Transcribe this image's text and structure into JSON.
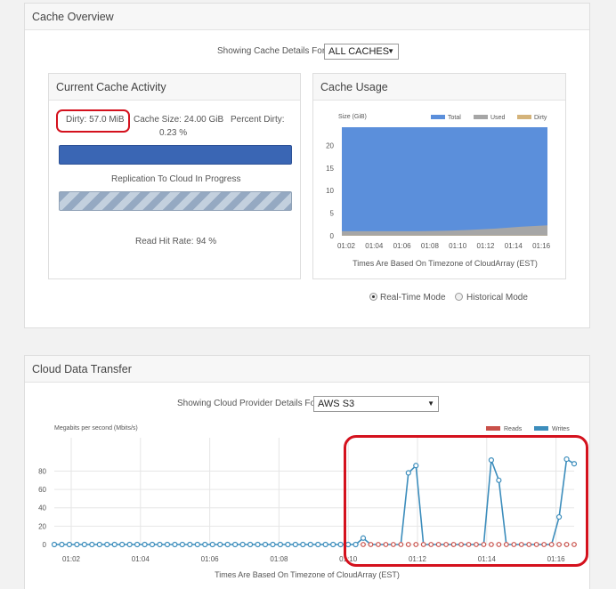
{
  "cache_overview": {
    "title": "Cache Overview",
    "showing_label": "Showing Cache Details For:",
    "cache_select": "ALL CACHES",
    "activity": {
      "title": "Current Cache Activity",
      "dirty": "Dirty: 57.0 MiB",
      "cache_size": "Cache Size: 24.00 GiB",
      "percent_dirty_label": "Percent Dirty:",
      "percent_dirty_value": "0.23 %",
      "replication_label": "Replication To Cloud In Progress",
      "read_hit_rate": "Read Hit Rate: 94 %"
    },
    "usage": {
      "title": "Cache Usage",
      "timezone_note": "Times Are Based On Timezone of CloudArray (EST)"
    },
    "modes": {
      "realtime": "Real-Time Mode",
      "historical": "Historical Mode",
      "selected": "realtime"
    }
  },
  "cloud_transfer": {
    "title": "Cloud Data Transfer",
    "showing_label": "Showing Cloud Provider Details For:",
    "provider_select": "AWS S3",
    "timezone_note": "Times Are Based On Timezone of CloudArray (EST)"
  },
  "colors": {
    "total": "#5b8fdb",
    "used": "#a6a6a6",
    "dirty": "#d4b37a",
    "reads": "#c9504a",
    "writes": "#3c8dbc",
    "highlight": "#d4111d"
  },
  "chart_data": [
    {
      "type": "area",
      "ylabel": "Size (GiB)",
      "x": [
        "01:02",
        "01:04",
        "01:06",
        "01:08",
        "01:10",
        "01:12",
        "01:14",
        "01:16"
      ],
      "yticks": [
        0,
        5,
        10,
        15,
        20
      ],
      "ylim": [
        0,
        24
      ],
      "legend": [
        "Total",
        "Used",
        "Dirty"
      ],
      "legend_position": "top-right",
      "series": [
        {
          "name": "Total",
          "values": [
            24,
            24,
            24,
            24,
            24,
            24,
            24,
            24,
            24
          ]
        },
        {
          "name": "Used",
          "values": [
            1.0,
            1.0,
            1.0,
            1.0,
            1.1,
            1.3,
            1.6,
            2.0,
            2.3
          ]
        },
        {
          "name": "Dirty",
          "values": [
            0.05,
            0.05,
            0.05,
            0.05,
            0.05,
            0.05,
            0.06,
            0.06,
            0.06
          ]
        }
      ]
    },
    {
      "type": "line",
      "ylabel": "Megabits per second (Mbits/s)",
      "x": [
        "01:02",
        "01:04",
        "01:06",
        "01:08",
        "01:10",
        "01:12",
        "01:14",
        "01:16"
      ],
      "yticks": [
        0,
        20,
        40,
        60,
        80
      ],
      "ylim": [
        0,
        95
      ],
      "legend": [
        "Reads",
        "Writes"
      ],
      "legend_position": "top-right",
      "grid": true,
      "series": [
        {
          "name": "Writes",
          "values": [
            0,
            0,
            0,
            0,
            0,
            0,
            0,
            0,
            0,
            0,
            0,
            0,
            0,
            0,
            0,
            0,
            0,
            0,
            0,
            0,
            0,
            0,
            0,
            0,
            0,
            0,
            0,
            0,
            0,
            0,
            0,
            0,
            0,
            0,
            0,
            0,
            0,
            0,
            0,
            0,
            0,
            7,
            0,
            0,
            0,
            0,
            0,
            78,
            86,
            0,
            0,
            0,
            0,
            0,
            0,
            0,
            0,
            0,
            92,
            70,
            0,
            0,
            0,
            0,
            0,
            0,
            0,
            30,
            93,
            88
          ]
        },
        {
          "name": "Reads",
          "values": [
            0,
            0,
            0,
            0,
            0,
            0,
            0,
            0,
            0,
            0,
            0,
            0,
            0,
            0,
            0,
            0,
            0,
            0,
            0,
            0,
            0,
            0,
            0,
            0,
            0,
            0,
            0,
            0,
            0,
            0,
            0,
            0,
            0,
            0,
            0,
            0,
            0,
            0,
            0,
            0,
            0,
            0,
            0,
            0,
            0,
            0,
            0,
            0,
            0,
            0,
            0,
            0,
            0,
            0,
            0,
            0,
            0,
            0,
            0,
            0,
            0,
            0,
            0,
            0,
            0,
            0,
            0,
            0,
            0,
            0
          ]
        }
      ]
    }
  ]
}
